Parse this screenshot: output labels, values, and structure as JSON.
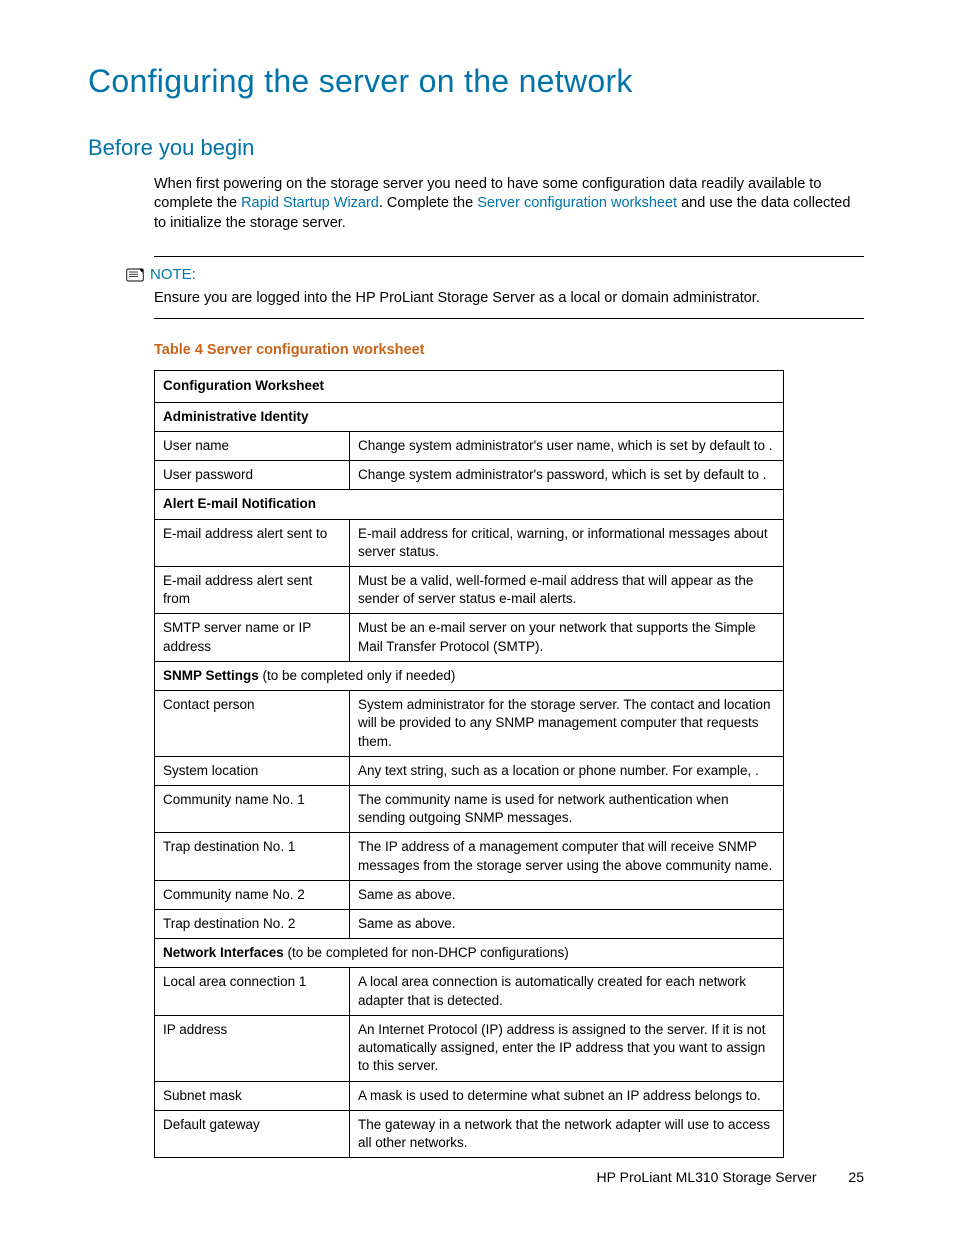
{
  "heading": "Configuring the server on the network",
  "subheading": "Before you begin",
  "intro": {
    "t1": "When first powering on the storage server you need to have some configuration data readily available to complete the ",
    "link1": "Rapid Startup Wizard",
    "t2": ". Complete the ",
    "link2": "Server configuration worksheet",
    "t3": " and use the data collected to initialize the storage server."
  },
  "note": {
    "label": "NOTE:",
    "text": "Ensure you are logged into the HP ProLiant Storage Server as a local or domain administrator."
  },
  "table_caption": "Table 4 Server configuration worksheet",
  "table": {
    "header": "Configuration Worksheet",
    "sections": {
      "admin": {
        "title": "Administrative Identity",
        "rows": {
          "r1": {
            "l": "User name",
            "r": "Change system administrator's user name, which is set by default to ."
          },
          "r2": {
            "l": "User password",
            "r": "Change system administrator's password, which is set by default to ."
          }
        }
      },
      "alert": {
        "title": "Alert E-mail Notification",
        "rows": {
          "r1": {
            "l": "E-mail address alert sent to",
            "r": "E-mail address for critical, warning, or informational messages about server status."
          },
          "r2": {
            "l": "E-mail address alert sent from",
            "r": "Must be a valid, well-formed e-mail address that will appear as the sender of server status e-mail alerts."
          },
          "r3": {
            "l": "SMTP server name or IP address",
            "r": "Must be an e-mail server on your network that supports the Simple Mail Transfer Protocol (SMTP)."
          }
        }
      },
      "snmp": {
        "title": "SNMP Settings",
        "paren": " (to be completed only if needed)",
        "rows": {
          "r1": {
            "l": "Contact person",
            "r": "System administrator for the storage server. The contact and location will be provided to any SNMP management computer that requests them."
          },
          "r2": {
            "l": "System location",
            "r": "Any text string, such as a location or phone number. For example, ."
          },
          "r3": {
            "l": "Community name No. 1",
            "r": "The community name is used for network authentication when sending outgoing SNMP messages."
          },
          "r4": {
            "l": "Trap destination No. 1",
            "r": "The IP address of a management computer that will receive SNMP messages from the storage server using the above community name."
          },
          "r5": {
            "l": "Community name No. 2",
            "r": "Same as above."
          },
          "r6": {
            "l": "Trap destination No. 2",
            "r": "Same as above."
          }
        }
      },
      "net": {
        "title": "Network Interfaces",
        "paren": " (to be completed for non-DHCP configurations)",
        "rows": {
          "r1": {
            "l": "Local area connection 1",
            "r": "A local area connection is automatically created for each network adapter that is detected."
          },
          "r2": {
            "l": "IP address",
            "r": "An Internet Protocol (IP) address is assigned to the server. If it is not automatically assigned, enter the IP address that you want to assign to this server."
          },
          "r3": {
            "l": "Subnet mask",
            "r": "A mask is used to determine what subnet an IP address belongs to."
          },
          "r4": {
            "l": "Default gateway",
            "r": "The gateway in a network that the network adapter will use to access all other networks."
          }
        }
      }
    }
  },
  "footer": {
    "product": "HP ProLiant ML310 Storage Server",
    "page": "25"
  }
}
